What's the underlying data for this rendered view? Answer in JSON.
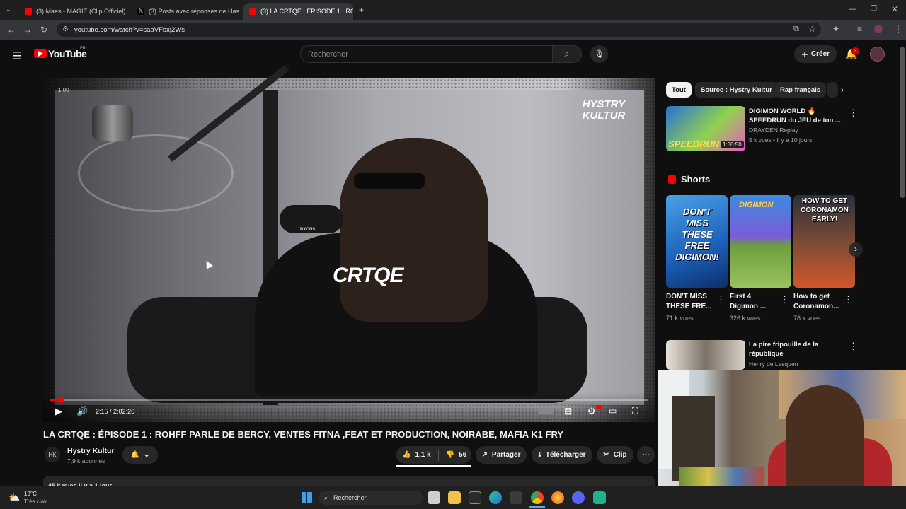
{
  "browser": {
    "tabs": [
      {
        "title": "(3) Maes - MAGIE (Clip Officiel)",
        "close": "×"
      },
      {
        "title": "(3) Posts avec réponses de Has",
        "close": "×"
      },
      {
        "title": "(3) LA CRTQE : ÉPISODE 1 : RO",
        "close": "×"
      }
    ],
    "new_tab": "+",
    "url": "youtube.com/watch?v=saaVFbxj2Ws"
  },
  "header": {
    "logo_text": "YouTube",
    "region": "FR",
    "search_placeholder": "Rechercher",
    "create_label": "Créer",
    "notif_count": "3"
  },
  "video": {
    "watermark": "HYSTRY KULTUR",
    "shirt_logo": "CRTQE",
    "mic_brand": "BYONS",
    "time_current": "2:15",
    "time_total": "2:02:26",
    "progress": 0.018,
    "top_left_badge": "1:00"
  },
  "title": "LA CRTQE : ÉPISODE 1 : ROHFF PARLE DE BERCY, VENTES FITNA ,FEAT ET PRODUCTION, NOIRABE, MAFIA K1 FRY",
  "channel": {
    "name": "Hystry Kultur",
    "subs": "7,9 k abonnés"
  },
  "actions": {
    "likes": "1,1 k",
    "dislikes": "56",
    "share": "Partager",
    "download": "Télécharger",
    "clip": "Clip"
  },
  "description_preview": "45 k vues  il y a 1 jour",
  "chips": [
    "Tout",
    "Source : Hystry Kultur",
    "Rap français"
  ],
  "recommended": [
    {
      "title": "DIGIMON WORLD 🔥 SPEEDRUN du JEU de ton ...",
      "channel": "DRAYDEN Replay",
      "meta": "5 k vues • il y a 10 jours",
      "duration": "1:30:50",
      "thumb_text": "SPEEDRUN"
    },
    {
      "title": "La pire fripouille de la république",
      "channel": "Henry de Lesquen",
      "meta": ""
    }
  ],
  "shorts": {
    "heading": "Shorts",
    "items": [
      {
        "title": "DON'T MISS THESE FRE...",
        "views": "71 k vues",
        "thumb_text": "DON'T MISS THESE FREE DIGIMON!"
      },
      {
        "title": "First 4 Digimon ...",
        "views": "326 k vues",
        "thumb_text": "DIGIMON"
      },
      {
        "title": "How to get Coronamon...",
        "views": "78 k vues",
        "thumb_text": "HOW TO GET CORONAMON EARLY!"
      }
    ]
  },
  "taskbar": {
    "weather_temp": "13°C",
    "weather_desc": "Très clair",
    "search": "Rechercher"
  }
}
